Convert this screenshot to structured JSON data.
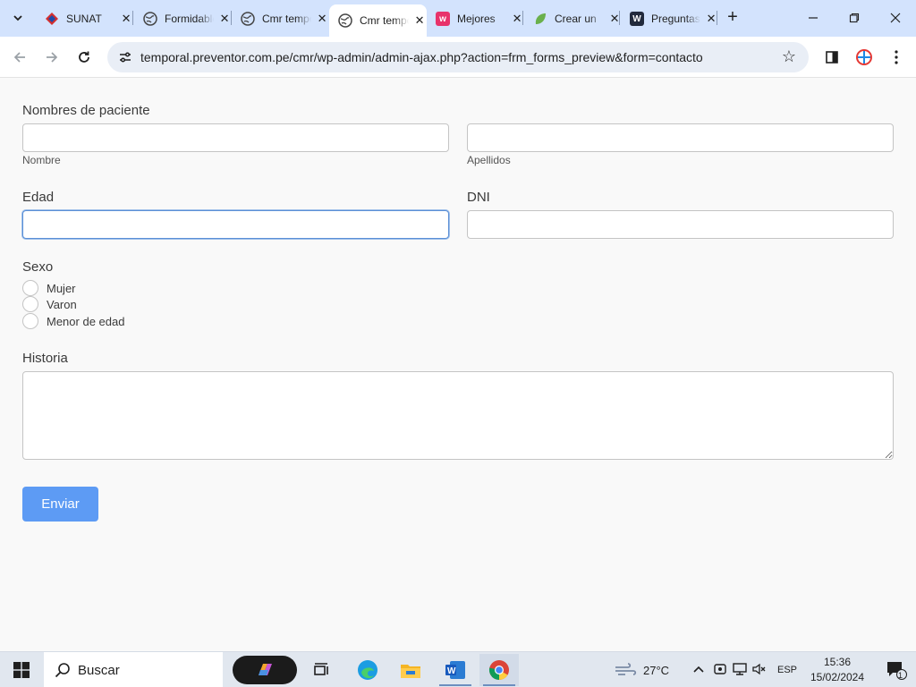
{
  "browser": {
    "tabs": [
      {
        "title": "SUNAT",
        "favicon": "sunat-icon",
        "active": false
      },
      {
        "title": "Formidable",
        "favicon": "globe-icon",
        "active": false
      },
      {
        "title": "Cmr temporal",
        "favicon": "globe-icon",
        "active": false
      },
      {
        "title": "Cmr temporal",
        "favicon": "globe-icon",
        "active": true
      },
      {
        "title": "Mejores",
        "favicon": "wix-w-icon",
        "active": false
      },
      {
        "title": "Crear un",
        "favicon": "leaf-icon",
        "active": false
      },
      {
        "title": "Preguntas",
        "favicon": "wordpress-w-icon",
        "active": false
      }
    ],
    "url": "temporal.preventor.com.pe/cmr/wp-admin/admin-ajax.php?action=frm_forms_preview&form=contacto"
  },
  "form": {
    "patient_names_label": "Nombres de paciente",
    "first_name_sublabel": "Nombre",
    "last_name_sublabel": "Apellidos",
    "age_label": "Edad",
    "dni_label": "DNI",
    "sex_label": "Sexo",
    "sex_options": [
      "Mujer",
      "Varon",
      "Menor de edad"
    ],
    "history_label": "Historia",
    "submit_label": "Enviar"
  },
  "taskbar": {
    "search_placeholder": "Buscar",
    "weather": "27°C",
    "language": "ESP",
    "time": "15:36",
    "date": "15/02/2024",
    "notification_count": "1"
  },
  "colors": {
    "accent_button": "#5d9bf4",
    "focus_border": "#5b8fd6",
    "tabstrip": "#d3e3fd"
  }
}
